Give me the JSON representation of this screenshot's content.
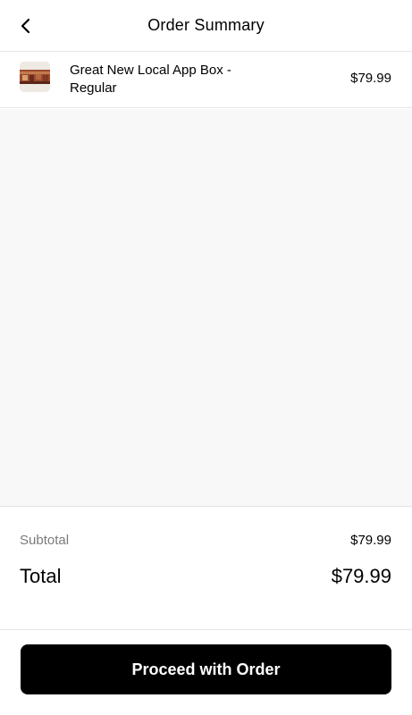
{
  "header": {
    "title": "Order Summary",
    "back_icon": "chevron-left-icon"
  },
  "items": [
    {
      "name": "Great New Local App Box  - Regular",
      "price": "$79.99",
      "thumbnail": "food-box-photo"
    }
  ],
  "summary": {
    "subtotal_label": "Subtotal",
    "subtotal_value": "$79.99",
    "total_label": "Total",
    "total_value": "$79.99"
  },
  "actions": {
    "proceed_label": "Proceed with Order"
  },
  "colors": {
    "background": "#ffffff",
    "empty_area": "#f8f8f8",
    "muted_text": "#7a7a7a",
    "button_bg": "#000000",
    "button_text": "#ffffff"
  }
}
